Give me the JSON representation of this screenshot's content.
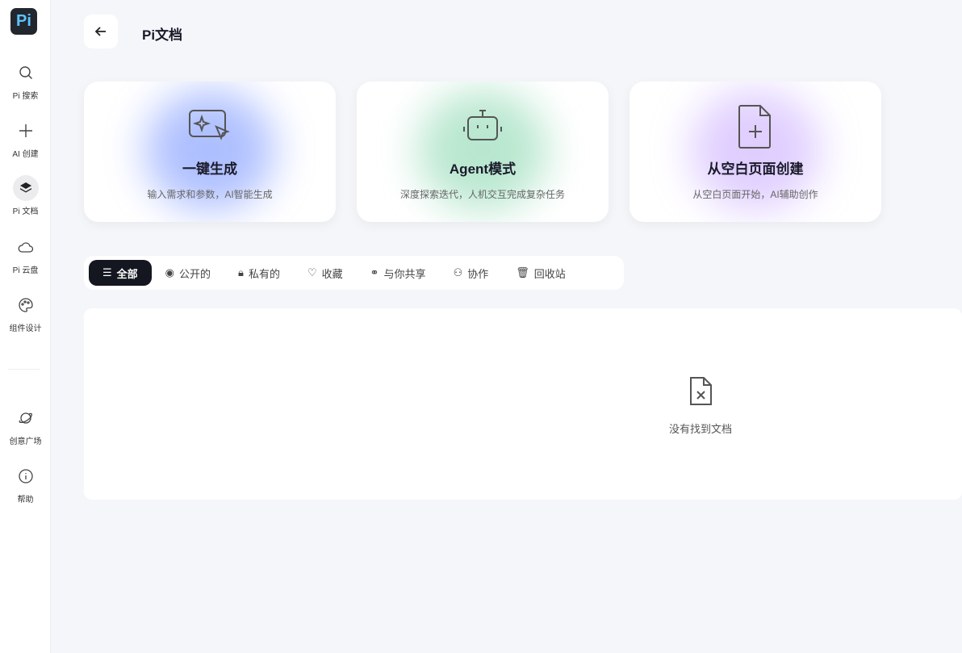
{
  "sidebar": {
    "logo": "Pi",
    "items": [
      {
        "label": "Pi 搜索",
        "icon": "search-icon"
      },
      {
        "label": "AI 创建",
        "icon": "plus-icon"
      },
      {
        "label": "Pi 文档",
        "icon": "layers-icon"
      },
      {
        "label": "Pi 云盘",
        "icon": "cloud-icon"
      },
      {
        "label": "组件设计",
        "icon": "palette-icon"
      },
      {
        "label": "创意广场",
        "icon": "planet-icon"
      },
      {
        "label": "帮助",
        "icon": "info-icon"
      }
    ]
  },
  "header": {
    "title": "Pi文档"
  },
  "cards": [
    {
      "title": "一键生成",
      "subtitle": "输入需求和参数，AI智能生成",
      "color": "#6d8cff"
    },
    {
      "title": "Agent模式",
      "subtitle": "深度探索迭代，人机交互完成复杂任务",
      "color": "#7fd4a8"
    },
    {
      "title": "从空白页面创建",
      "subtitle": "从空白页面开始，AI辅助创作",
      "color": "#c6a6ff"
    }
  ],
  "tabs": [
    {
      "label": "全部"
    },
    {
      "label": "公开的"
    },
    {
      "label": "私有的"
    },
    {
      "label": "收藏"
    },
    {
      "label": "与你共享"
    },
    {
      "label": "协作"
    },
    {
      "label": "回收站"
    }
  ],
  "empty": {
    "message": "没有找到文档"
  }
}
